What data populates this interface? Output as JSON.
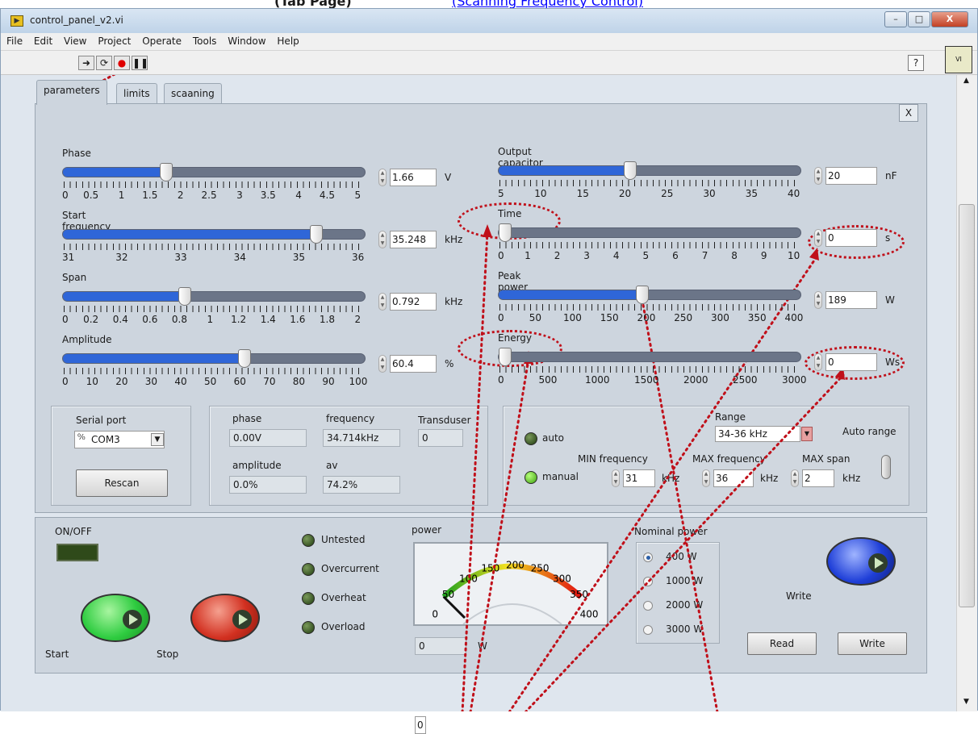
{
  "top_caption": {
    "left_text": "(Tab Page)",
    "right_text": "(Scanning Frequency Control)"
  },
  "window": {
    "title": "control_panel_v2.vi",
    "minimize": "–",
    "maximize": "□",
    "close": "X"
  },
  "menu": [
    "File",
    "Edit",
    "View",
    "Project",
    "Operate",
    "Tools",
    "Window",
    "Help"
  ],
  "toolbar": {
    "help": "?"
  },
  "tabs": [
    "parameters",
    "limits",
    "scaaning"
  ],
  "tab_close": "X",
  "sliders_left": [
    {
      "label": "Phase",
      "value": "1.66",
      "unit": "V",
      "ticks": [
        "0",
        "0.5",
        "1",
        "1.5",
        "2",
        "2.5",
        "3",
        "3.5",
        "4",
        "4.5",
        "5"
      ],
      "fraction": 0.332
    },
    {
      "label": "Start frequency",
      "value": "35.248",
      "unit": "kHz",
      "ticks": [
        "31",
        "32",
        "33",
        "34",
        "35",
        "36"
      ],
      "fraction": 0.85
    },
    {
      "label": "Span",
      "value": "0.792",
      "unit": "kHz",
      "ticks": [
        "0",
        "0.2",
        "0.4",
        "0.6",
        "0.8",
        "1",
        "1.2",
        "1.4",
        "1.6",
        "1.8",
        "2"
      ],
      "fraction": 0.396
    },
    {
      "label": "Amplitude",
      "value": "60.4",
      "unit": "%",
      "ticks": [
        "0",
        "10",
        "20",
        "30",
        "40",
        "50",
        "60",
        "70",
        "80",
        "90",
        "100"
      ],
      "fraction": 0.604
    }
  ],
  "sliders_right": [
    {
      "label": "Output capacitor",
      "value": "20",
      "unit": "nF",
      "ticks": [
        "5",
        "10",
        "15",
        "20",
        "25",
        "30",
        "35",
        "40"
      ],
      "fraction": 0.43
    },
    {
      "label": "Time",
      "value": "0",
      "unit": "s",
      "ticks": [
        "0",
        "1",
        "2",
        "3",
        "4",
        "5",
        "6",
        "7",
        "8",
        "9",
        "10"
      ],
      "fraction": 0.0
    },
    {
      "label": "Peak power",
      "value": "189",
      "unit": "W",
      "ticks": [
        "0",
        "50",
        "100",
        "150",
        "200",
        "250",
        "300",
        "350",
        "400"
      ],
      "fraction": 0.472
    },
    {
      "label": "Energy",
      "value": "0",
      "unit": "Ws",
      "ticks": [
        "0",
        "500",
        "1000",
        "1500",
        "2000",
        "2500",
        "3000"
      ],
      "fraction": 0.0
    }
  ],
  "serial": {
    "label": "Serial port",
    "value": "COM3",
    "rescan": "Rescan"
  },
  "readouts": {
    "phase_label": "phase",
    "phase_value": "0.00V",
    "frequency_label": "frequency",
    "frequency_value": "34.714kHz",
    "transducer_label": "Transduser",
    "transducer_value": "0",
    "amplitude_label": "amplitude",
    "amplitude_value": "0.0%",
    "av_label": "av",
    "av_value": "74.2%"
  },
  "scan": {
    "auto_label": "auto",
    "manual_label": "manual",
    "range_label": "Range",
    "range_value": "34-36 kHz",
    "auto_range_label": "Auto range",
    "min_freq_label": "MIN frequency",
    "min_freq_value": "31",
    "min_unit": "kHz",
    "max_freq_label": "MAX frequency",
    "max_freq_value": "36",
    "max_unit": "kHz",
    "max_span_label": "MAX span",
    "max_span_value": "2",
    "span_unit": "kHz"
  },
  "control": {
    "onoff_label": "ON/OFF",
    "start_label": "Start",
    "stop_label": "Stop",
    "status": [
      "Untested",
      "Overcurrent",
      "Overheat",
      "Overload"
    ],
    "power_label": "power",
    "gauge_ticks": [
      "0",
      "50",
      "100",
      "150",
      "200",
      "250",
      "300",
      "350",
      "400"
    ],
    "gauge_value": 0,
    "power_value": "0",
    "power_unit": "W",
    "nominal_label": "Nominal power",
    "nominal_options": [
      "400 W",
      "1000 W",
      "2000 W",
      "3000 W"
    ],
    "nominal_selected": 0,
    "write_label": "Write",
    "read_button": "Read",
    "write_button": "Write"
  },
  "colors": {
    "slider_fill": "#2f66d8",
    "annotation": "#c0101a",
    "start_button": "#2ecc40",
    "stop_button": "#d23020",
    "write_button": "#1f3fd8"
  }
}
